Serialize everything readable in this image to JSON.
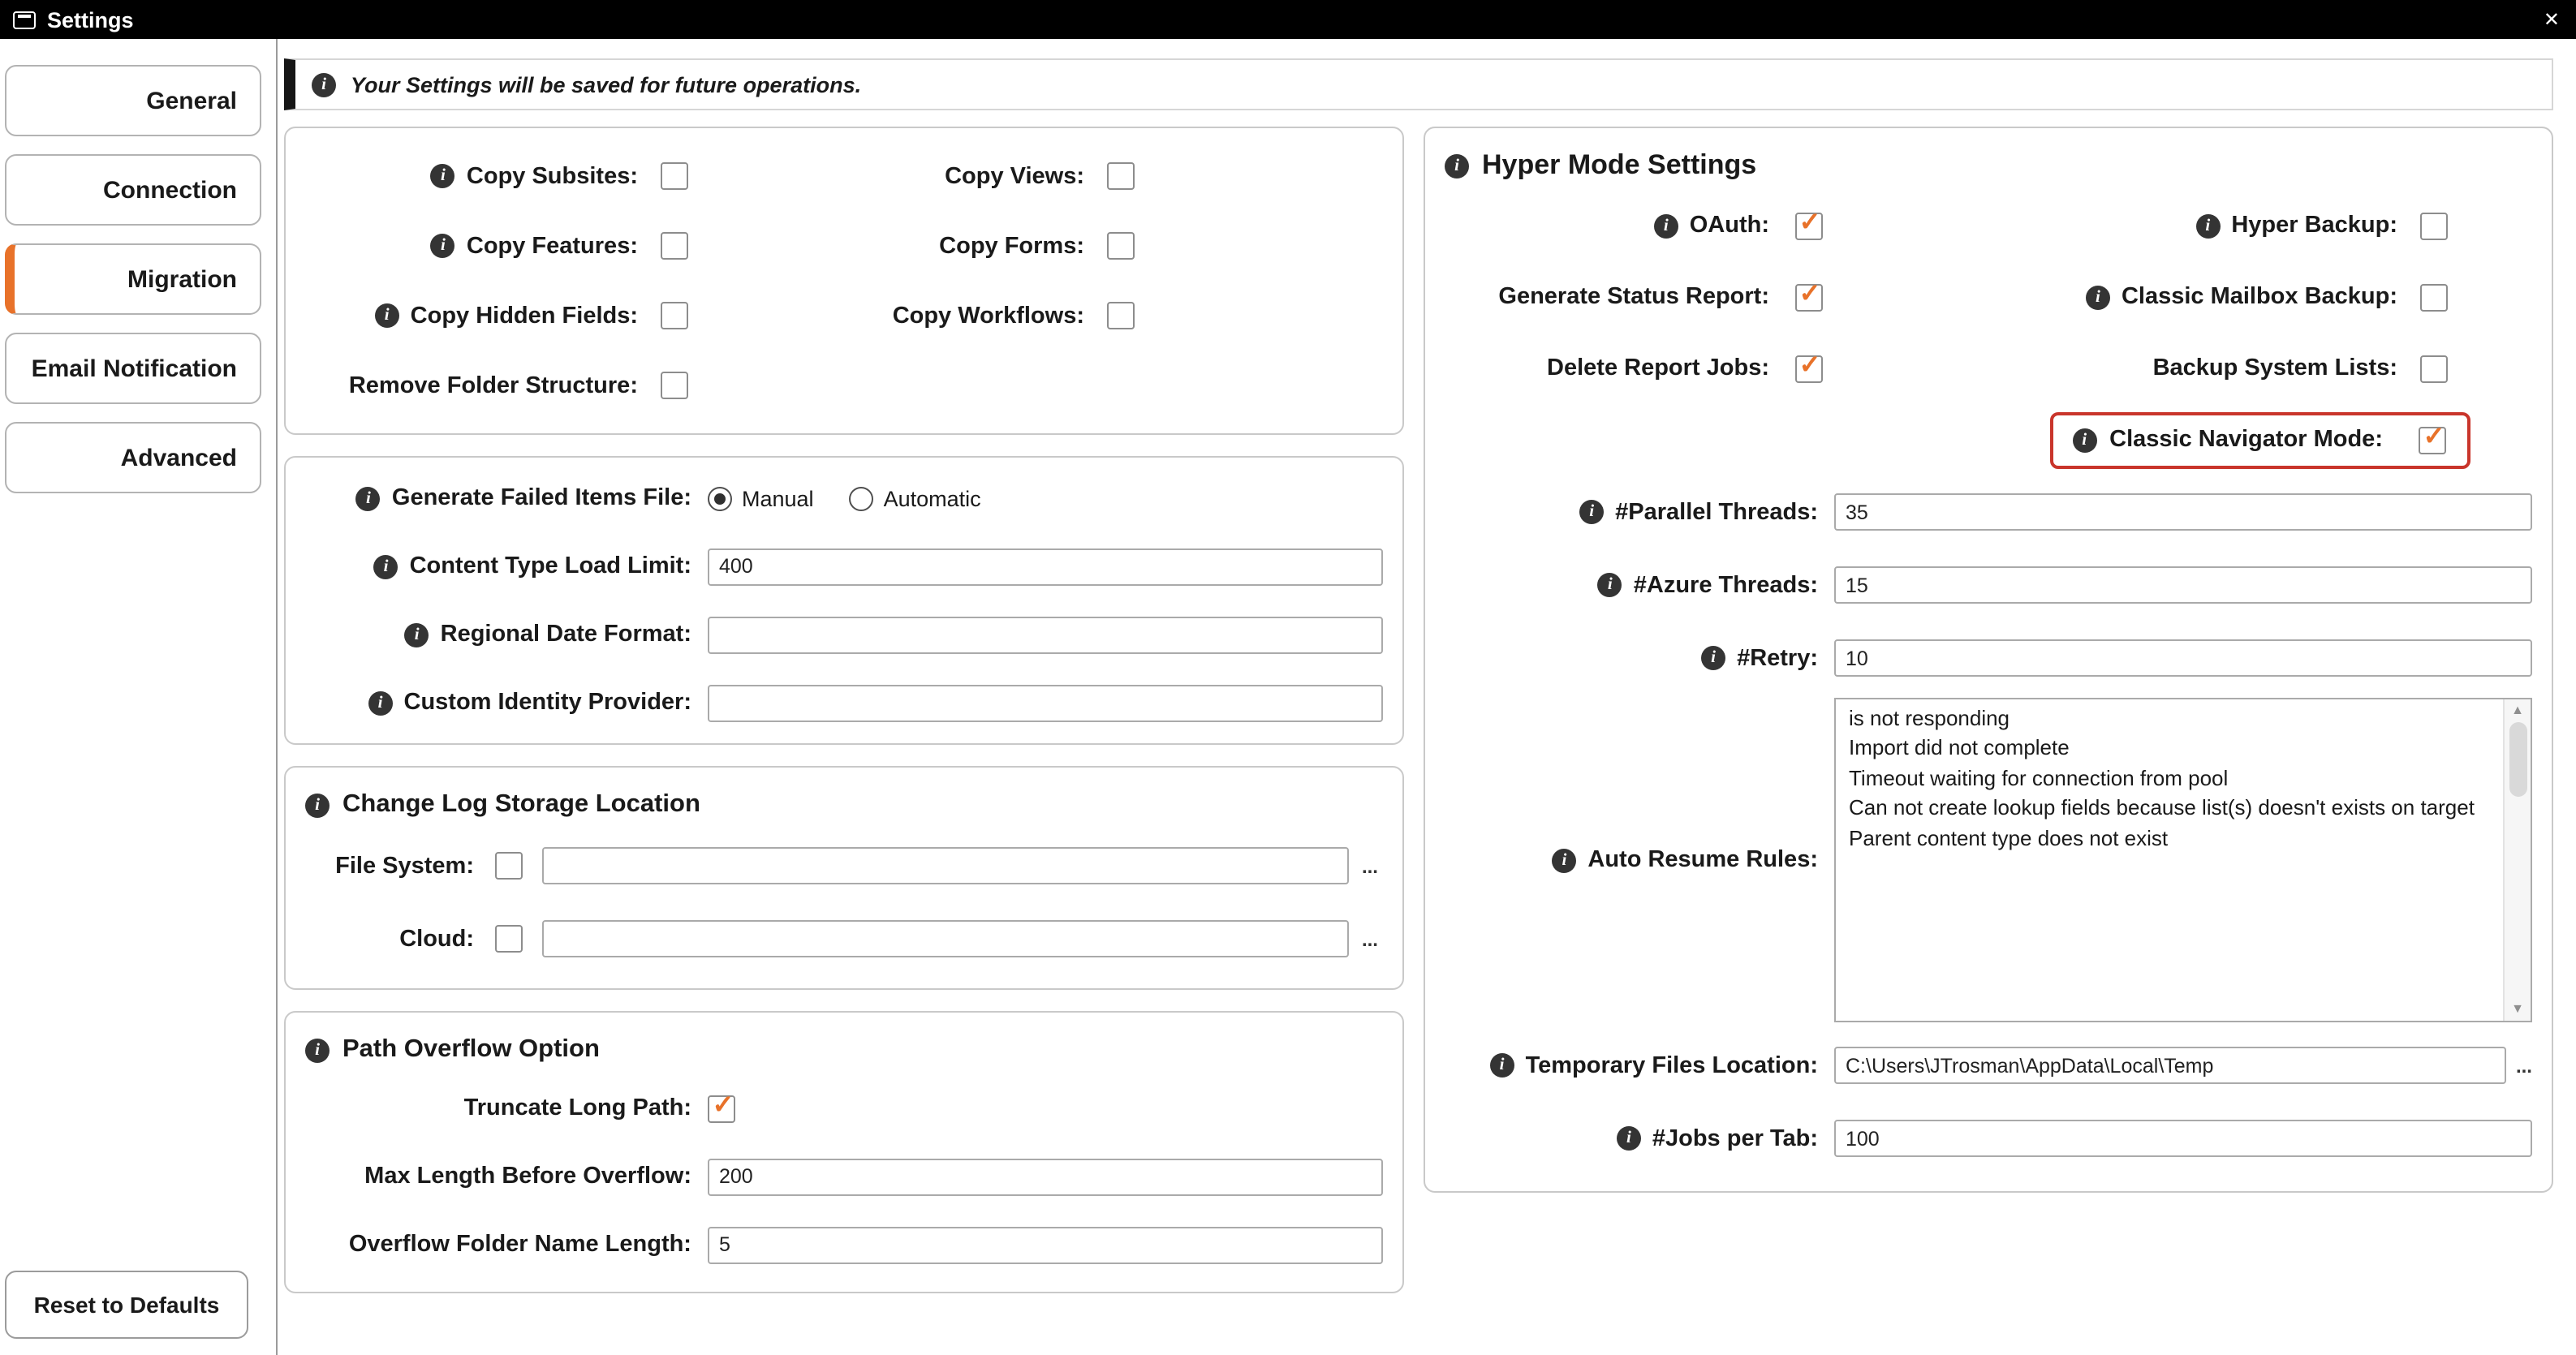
{
  "colors": {
    "accent": "#e8722a",
    "highlight": "#c9352b",
    "titlebar": "#000000"
  },
  "icons": {
    "info": "i",
    "close": "✕",
    "check": "✓",
    "browse": "...",
    "scroll_up": "▲",
    "scroll_down": "▼"
  },
  "window": {
    "title": "Settings"
  },
  "sidebar": {
    "tabs": [
      {
        "id": "general",
        "label": "General",
        "selected": false
      },
      {
        "id": "connection",
        "label": "Connection",
        "selected": false
      },
      {
        "id": "migration",
        "label": "Migration",
        "selected": true
      },
      {
        "id": "email-notification",
        "label": "Email Notification",
        "selected": false
      },
      {
        "id": "advanced",
        "label": "Advanced",
        "selected": false
      }
    ],
    "reset_label": "Reset to Defaults"
  },
  "banner": {
    "message": "Your Settings will be saved for future operations."
  },
  "copy_options": {
    "rows": [
      {
        "left": {
          "label": "Copy Subsites:",
          "info": true,
          "checked": false
        },
        "right": {
          "label": "Copy Views:",
          "info": false,
          "checked": false
        }
      },
      {
        "left": {
          "label": "Copy Features:",
          "info": true,
          "checked": false
        },
        "right": {
          "label": "Copy Forms:",
          "info": false,
          "checked": false
        }
      },
      {
        "left": {
          "label": "Copy Hidden Fields:",
          "info": true,
          "checked": false
        },
        "right": {
          "label": "Copy Workflows:",
          "info": false,
          "checked": false
        }
      },
      {
        "left": {
          "label": "Remove Folder Structure:",
          "info": false,
          "checked": false
        }
      }
    ]
  },
  "failed_items": {
    "label": "Generate Failed Items File:",
    "radio": {
      "options": [
        "Manual",
        "Automatic"
      ],
      "selected": "Manual"
    },
    "content_type_load_limit": {
      "label": "Content Type Load Limit:",
      "value": "400"
    },
    "regional_date_format": {
      "label": "Regional Date Format:",
      "value": ""
    },
    "custom_identity_provider": {
      "label": "Custom Identity Provider:",
      "value": ""
    }
  },
  "change_log": {
    "title": "Change Log Storage Location",
    "file_system": {
      "label": "File System:",
      "checked": false,
      "value": ""
    },
    "cloud": {
      "label": "Cloud:",
      "checked": false,
      "value": ""
    }
  },
  "path_overflow": {
    "title": "Path Overflow Option",
    "truncate_long_path": {
      "label": "Truncate Long Path:",
      "checked": true
    },
    "max_length_before_overflow": {
      "label": "Max Length Before Overflow:",
      "value": "200"
    },
    "overflow_folder_name_length": {
      "label": "Overflow Folder Name Length:",
      "value": "5"
    }
  },
  "hyper": {
    "title": "Hyper Mode Settings",
    "checkboxes": {
      "oauth": {
        "label": "OAuth:",
        "checked": true
      },
      "hyper_backup": {
        "label": "Hyper Backup:",
        "checked": false
      },
      "generate_status_report": {
        "label": "Generate Status Report:",
        "checked": true
      },
      "classic_mailbox_backup": {
        "label": "Classic Mailbox Backup:",
        "checked": false
      },
      "delete_report_jobs": {
        "label": "Delete Report Jobs:",
        "checked": true
      },
      "backup_system_lists": {
        "label": "Backup System Lists:",
        "checked": false
      },
      "classic_navigator_mode": {
        "label": "Classic Navigator Mode:",
        "checked": true,
        "highlighted": true
      }
    },
    "fields": {
      "parallel_threads": {
        "label": "#Parallel Threads:",
        "value": "35"
      },
      "azure_threads": {
        "label": "#Azure Threads:",
        "value": "15"
      },
      "retry": {
        "label": "#Retry:",
        "value": "10"
      },
      "auto_resume_rules": {
        "label": "Auto Resume Rules:",
        "value": "is not responding\nImport did not complete\nTimeout waiting for connection from pool\nCan not create lookup fields because list(s) doesn't exists on target\nParent content type does not exist"
      },
      "temporary_files_location": {
        "label": "Temporary Files Location:",
        "value": "C:\\Users\\JTrosman\\AppData\\Local\\Temp"
      },
      "jobs_per_tab": {
        "label": "#Jobs per Tab:",
        "value": "100"
      }
    }
  }
}
